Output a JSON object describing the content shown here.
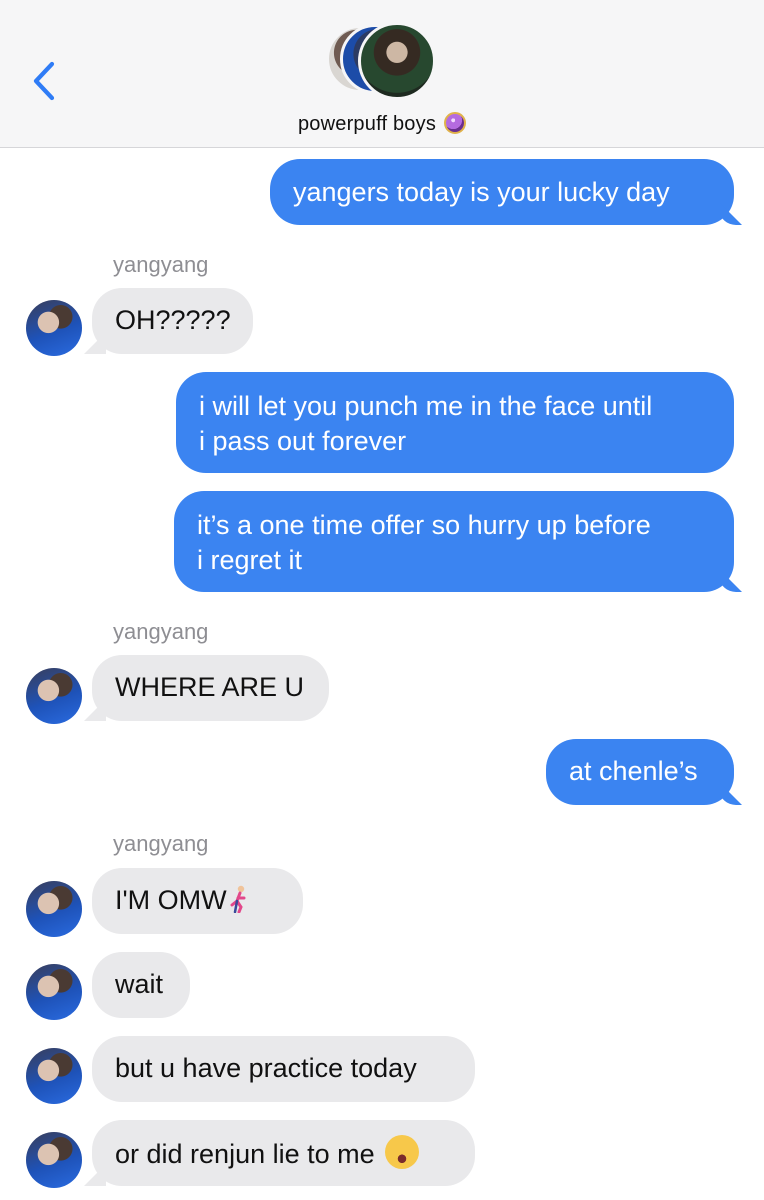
{
  "header": {
    "group_name": "powerpuff boys",
    "group_emoji_icon": "crystal-ball-icon",
    "back_icon": "chevron-left-icon",
    "accent_color": "#3b84f1"
  },
  "messages": [
    {
      "type": "sent",
      "text": "yangers today is your lucky day"
    },
    {
      "type": "sender_name",
      "text": "yangyang"
    },
    {
      "type": "received",
      "text": "OH?????"
    },
    {
      "type": "sent",
      "text": "i will let you punch me in the face until\ni pass out forever"
    },
    {
      "type": "sent",
      "text": "it’s a one time offer so hurry up before\ni regret it"
    },
    {
      "type": "sender_name",
      "text": "yangyang"
    },
    {
      "type": "received",
      "text": "WHERE ARE U"
    },
    {
      "type": "sent",
      "text": "at chenle’s"
    },
    {
      "type": "sender_name",
      "text": "yangyang"
    },
    {
      "type": "received",
      "text": "I'M OMW",
      "emoji": "running-man-emoji"
    },
    {
      "type": "received",
      "text": "wait"
    },
    {
      "type": "received",
      "text": "but u have practice today"
    },
    {
      "type": "received",
      "text": "or did renjun lie to me",
      "emoji": "crying-face-emoji"
    }
  ],
  "colors": {
    "sent_bubble": "#3b84f1",
    "received_bubble": "#e9e9eb",
    "sender_label": "#8e8e93"
  }
}
